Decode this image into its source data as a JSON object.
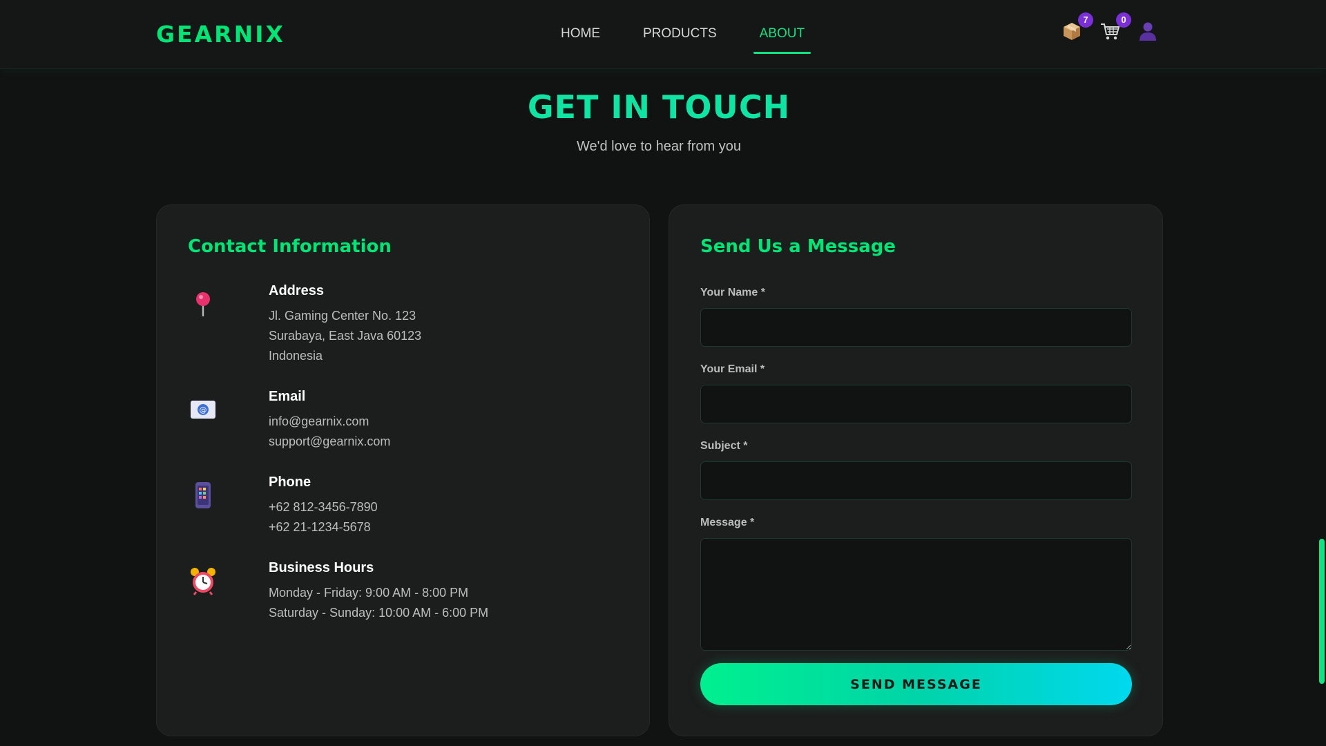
{
  "brand": {
    "name": "GEARNIX",
    "accent": "#00e676",
    "accent_alt": "#0fe5a2",
    "badge_color": "#7b2fd6"
  },
  "nav": {
    "items": [
      {
        "label": "HOME",
        "active": false
      },
      {
        "label": "PRODUCTS",
        "active": false
      },
      {
        "label": "ABOUT",
        "active": true
      }
    ],
    "icons": [
      {
        "icon": "package-icon",
        "badge": "7"
      },
      {
        "icon": "cart-icon",
        "badge": "0"
      },
      {
        "icon": "user-icon"
      }
    ]
  },
  "hero": {
    "title": "GET IN TOUCH",
    "subtitle": "We'd love to hear from you"
  },
  "contact": {
    "title": "Contact Information",
    "address": {
      "heading": "Address",
      "icon": "pin-icon",
      "lines": [
        "Jl. Gaming Center No. 123",
        "Surabaya, East Java 60123",
        "Indonesia"
      ]
    },
    "email": {
      "heading": "Email",
      "icon": "email-icon",
      "lines": [
        "info@gearnix.com",
        "support@gearnix.com"
      ]
    },
    "phone": {
      "heading": "Phone",
      "icon": "phone-icon",
      "lines": [
        "+62 812-3456-7890",
        "+62 21-1234-5678"
      ]
    },
    "hours": {
      "heading": "Business Hours",
      "icon": "alarm-clock-icon",
      "lines": [
        "Monday - Friday: 9:00 AM - 8:00 PM",
        "Saturday - Sunday: 10:00 AM - 6:00 PM"
      ]
    }
  },
  "form": {
    "title": "Send Us a Message",
    "name_label": "Your Name *",
    "name_value": "",
    "email_label": "Your Email *",
    "email_value": "",
    "subject_label": "Subject *",
    "subject_value": "",
    "message_label": "Message *",
    "message_value": "",
    "submit_label": "SEND MESSAGE"
  }
}
